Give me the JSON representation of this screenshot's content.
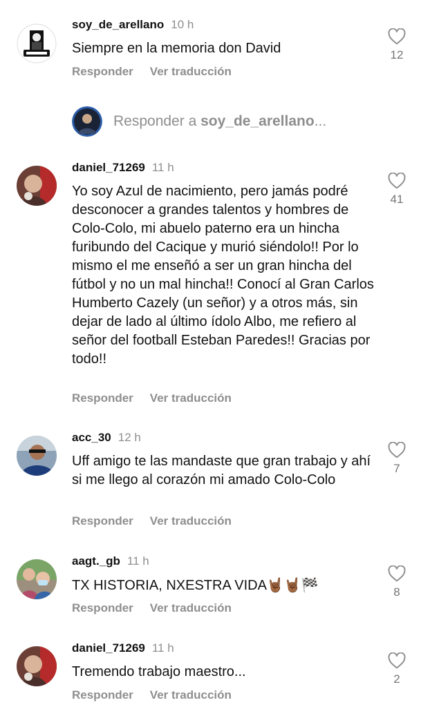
{
  "actions": {
    "reply_label": "Responder",
    "translate_label": "Ver traducción"
  },
  "reply_box": {
    "prefix": "Responder a ",
    "target": "soy_de_arellano",
    "ellipsis": "..."
  },
  "comments": [
    {
      "username": "soy_de_arellano",
      "time": "10 h",
      "text": "Siempre en la memoria don David",
      "likes": "12",
      "avatar": "arellano-logo"
    },
    {
      "username": "daniel_71269",
      "time": "11 h",
      "text": "Yo soy Azul de nacimiento, pero jamás podré desconocer a grandes talentos y hombres de Colo-Colo, mi abuelo paterno era un hincha furibundo del Cacique y murió siéndolo!! Por lo mismo el me enseñó a ser un gran hincha del fútbol y no un mal hincha!! Conocí al Gran Carlos Humberto Cazely (un señor) y a otros más, sin dejar de lado al último ídolo Albo, me refiero al señor del football Esteban Paredes!! Gracias por todo!!",
      "likes": "41",
      "avatar": "user-photo"
    },
    {
      "username": "acc_30",
      "time": "12 h",
      "text": "Uff amigo te las mandaste que gran trabajo y ahí si me llego al corazón mi amado Colo-Colo",
      "likes": "7",
      "avatar": "user-photo"
    },
    {
      "username": "aagt._gb",
      "time": "11 h",
      "text": "TX HISTORIA, NXESTRA VIDA",
      "text_emoji": "🤘🏾🤘🏾🏁",
      "likes": "8",
      "avatar": "user-photo"
    },
    {
      "username": "daniel_71269",
      "time": "11 h",
      "text": "Tremendo trabajo maestro...",
      "likes": "2",
      "avatar": "user-photo"
    }
  ],
  "colors": {
    "text_primary": "#111111",
    "text_secondary": "#8e8e8e",
    "like_count": "#737373",
    "heart_outline": "#8e8e8e"
  }
}
